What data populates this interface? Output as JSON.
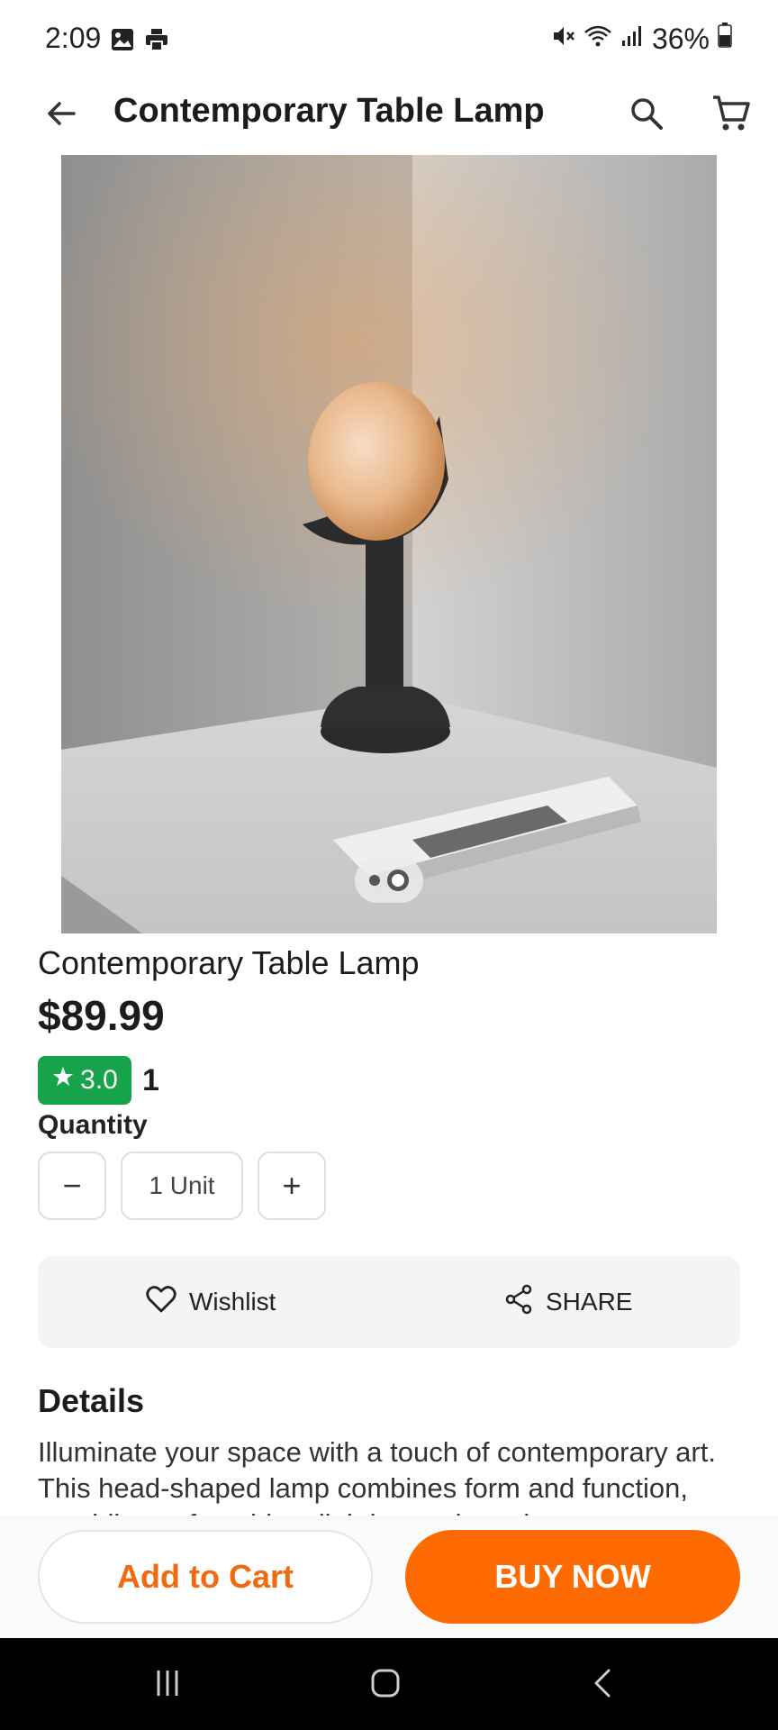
{
  "status_bar": {
    "time": "2:09",
    "battery": "36%",
    "icons": [
      "gallery-icon",
      "printer-icon",
      "mute-icon",
      "wifi-icon",
      "signal-icon",
      "battery-icon"
    ]
  },
  "app_bar": {
    "title": "Contemporary Table Lamp",
    "icons": [
      "back-arrow-icon",
      "search-icon",
      "cart-icon"
    ]
  },
  "product": {
    "name": "Contemporary Table Lamp",
    "price": "$89.99",
    "rating": "3.0",
    "rating_count": "1",
    "image_count": 2,
    "active_image_index": 2
  },
  "quantity": {
    "label": "Quantity",
    "value": "1 Unit",
    "minus": "−",
    "plus": "+"
  },
  "actions": {
    "wishlist": "Wishlist",
    "share": "SHARE"
  },
  "details": {
    "heading": "Details",
    "text": "Illuminate your space with a touch of contemporary art. This head-shaped lamp combines form and function, providing soft ambient lighting and a unique"
  },
  "bottom_bar": {
    "add_to_cart": "Add to Cart",
    "buy_now": "BUY NOW"
  },
  "colors": {
    "accent": "#ff6b00",
    "rating_green": "#16a34a"
  }
}
